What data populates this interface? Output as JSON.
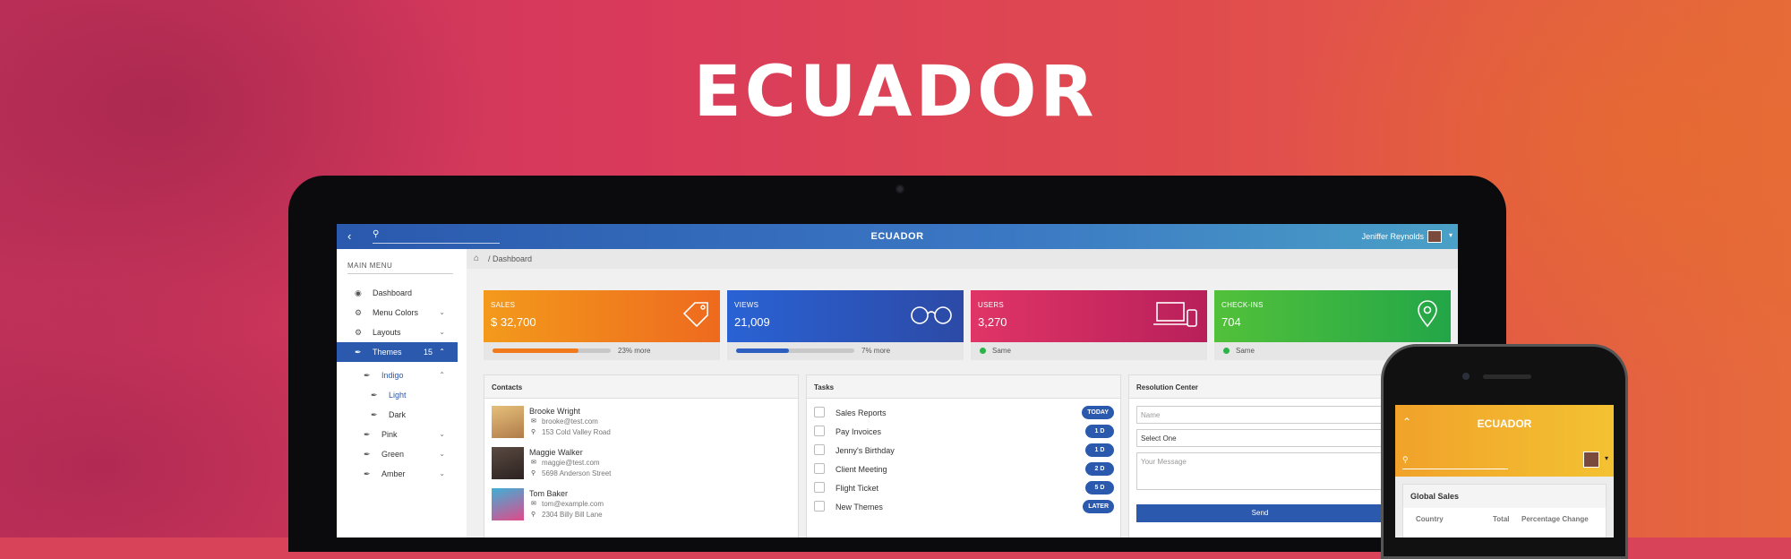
{
  "brand": "ECUADOR",
  "app": {
    "title": "ECUADOR",
    "user_name": "Jeniffer Reynolds",
    "search_icon": "search-icon",
    "back_icon": "chevron-left-icon"
  },
  "sidebar": {
    "menu_title": "MAIN MENU",
    "items": [
      {
        "label": "Dashboard",
        "icon": "dashboard-icon"
      },
      {
        "label": "Menu Colors",
        "icon": "gear-icon"
      },
      {
        "label": "Layouts",
        "icon": "gear-icon"
      },
      {
        "label": "Themes",
        "icon": "brush-icon",
        "count": "15"
      },
      {
        "label": "Indigo",
        "icon": "brush-icon"
      },
      {
        "label": "Light",
        "icon": "brush-icon"
      },
      {
        "label": "Dark",
        "icon": "brush-icon"
      },
      {
        "label": "Pink",
        "icon": "brush-icon"
      },
      {
        "label": "Green",
        "icon": "brush-icon"
      },
      {
        "label": "Amber",
        "icon": "brush-icon"
      }
    ]
  },
  "breadcrumb": {
    "path": "/ Dashboard"
  },
  "stats": [
    {
      "label": "SALES",
      "value": "$ 32,700",
      "footer": "23% more",
      "progress": 0.73,
      "color": "#f07a1d"
    },
    {
      "label": "VIEWS",
      "value": "21,009",
      "footer": "7% more",
      "progress": 0.45,
      "color": "#2d5fc0"
    },
    {
      "label": "USERS",
      "value": "3,270",
      "footer": "Same",
      "color": "#d92e63"
    },
    {
      "label": "CHECK-INS",
      "value": "704",
      "footer": "Same",
      "color": "#2db34a"
    }
  ],
  "contacts": {
    "title": "Contacts",
    "items": [
      {
        "name": "Brooke Wright",
        "email": "brooke@test.com",
        "address": "153 Cold Valley Road"
      },
      {
        "name": "Maggie Walker",
        "email": "maggie@test.com",
        "address": "5698 Anderson Street"
      },
      {
        "name": "Tom Baker",
        "email": "tom@example.com",
        "address": "2304 Billy Bill Lane"
      }
    ]
  },
  "tasks": {
    "title": "Tasks",
    "items": [
      {
        "name": "Sales Reports",
        "badge": "TODAY"
      },
      {
        "name": "Pay Invoices",
        "badge": "1 D"
      },
      {
        "name": "Jenny's Birthday",
        "badge": "1 D"
      },
      {
        "name": "Client Meeting",
        "badge": "2 D"
      },
      {
        "name": "Flight Ticket",
        "badge": "5 D"
      },
      {
        "name": "New Themes",
        "badge": "LATER"
      }
    ]
  },
  "resolution": {
    "title": "Resolution Center",
    "name_placeholder": "Name",
    "select_value": "Select One",
    "message_placeholder": "Your Message",
    "send_label": "Send"
  },
  "phone": {
    "title": "ECUADOR",
    "card_title": "Global Sales",
    "columns": [
      "Country",
      "Total",
      "Percentage Change"
    ]
  }
}
